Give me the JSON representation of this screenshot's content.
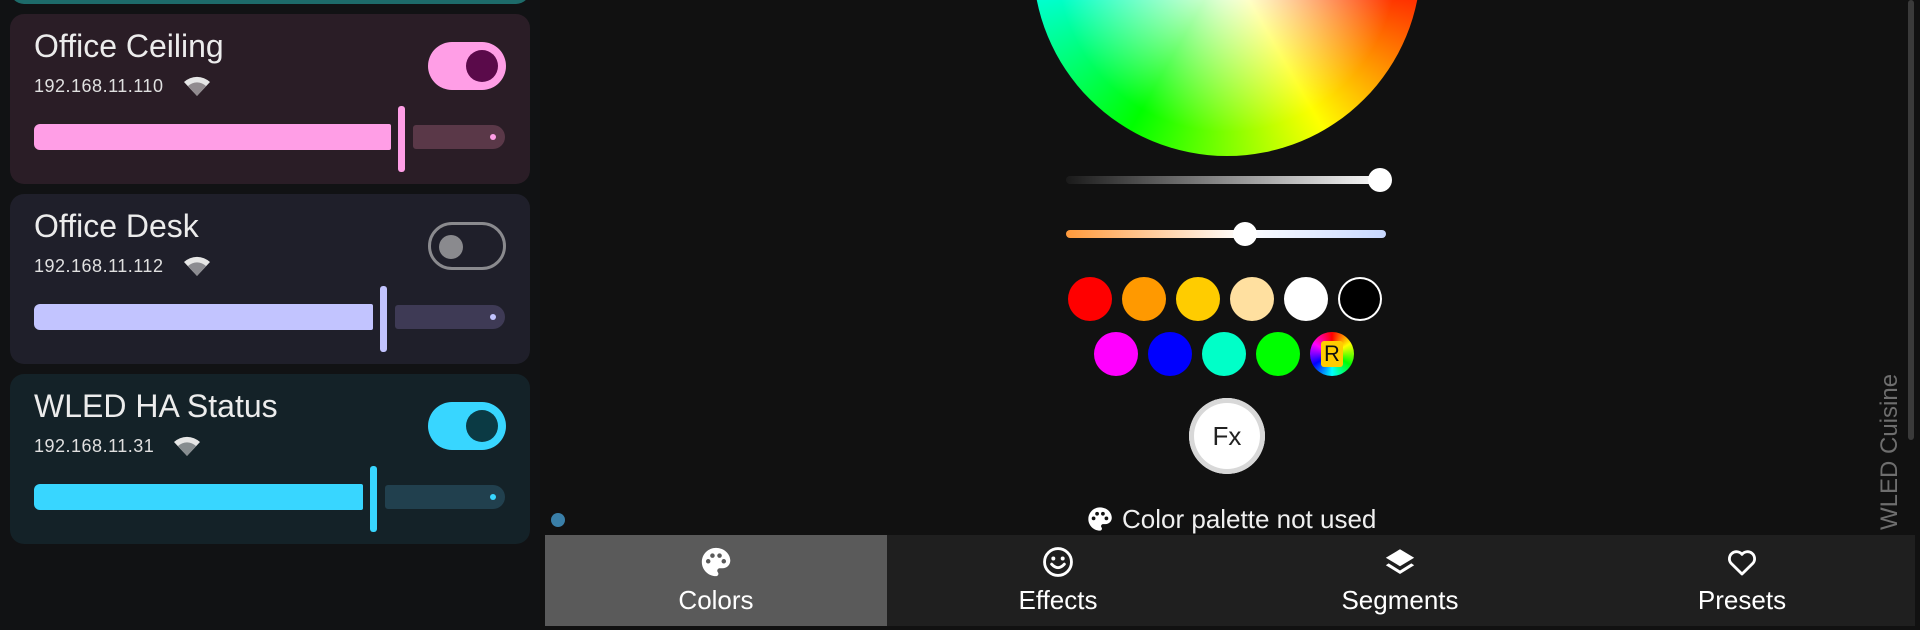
{
  "devices": [
    {
      "name": "Office Ceiling",
      "ip": "192.168.11.110",
      "on": true,
      "brightness_fraction": 0.78,
      "colors": {
        "card_bg": "#2a1d26",
        "accent": "#ff9ee6",
        "knob": "#5a0a4a",
        "rest": "#5a3848",
        "rest_dot": "#ff9ee6"
      }
    },
    {
      "name": "Office Desk",
      "ip": "192.168.11.112",
      "on": false,
      "brightness_fraction": 0.74,
      "colors": {
        "card_bg": "#1f1f2a",
        "accent": "#c2c4ff",
        "knob": "#8a8a8e",
        "rest": "#3e3a55",
        "rest_dot": "#c2c4ff"
      }
    },
    {
      "name": "WLED HA Status",
      "ip": "192.168.11.31",
      "on": true,
      "brightness_fraction": 0.72,
      "colors": {
        "card_bg": "#142228",
        "accent": "#38d6ff",
        "knob": "#0b3a44",
        "rest": "#21404e",
        "rest_dot": "#38d6ff"
      }
    }
  ],
  "color_controls": {
    "brightness_fraction": 0.98,
    "temperature_fraction": 0.56,
    "swatches_row1": [
      "#ff0000",
      "#ff9900",
      "#ffcc00",
      "#ffe0a0",
      "#ffffff",
      "#000000"
    ],
    "swatches_row2": [
      "#ff00ff",
      "#0000ff",
      "#00ffc8",
      "#00ff00",
      "rainbow"
    ],
    "random_label": "R",
    "fx_label": "Fx",
    "palette_note": "Color palette not used"
  },
  "side_label": "WLED Cuisine",
  "tabs": [
    {
      "label": "Colors",
      "icon": "palette-icon",
      "active": true
    },
    {
      "label": "Effects",
      "icon": "smiley-icon",
      "active": false
    },
    {
      "label": "Segments",
      "icon": "layers-icon",
      "active": false
    },
    {
      "label": "Presets",
      "icon": "heart-icon",
      "active": false
    }
  ]
}
